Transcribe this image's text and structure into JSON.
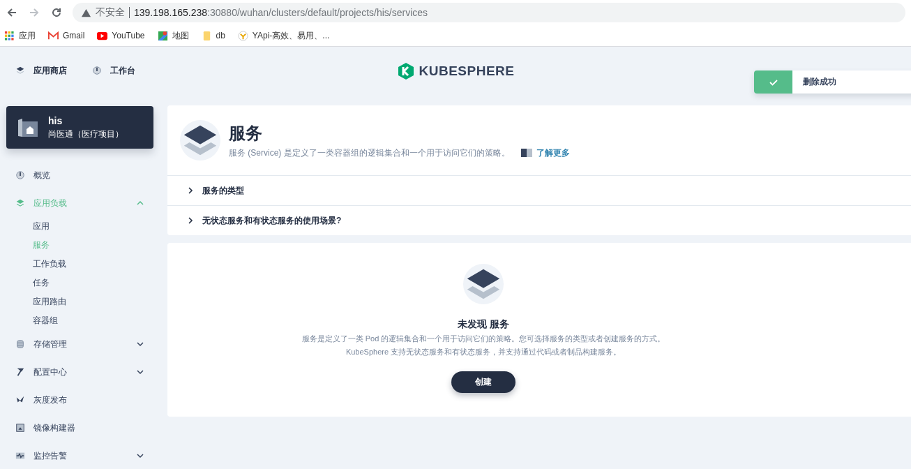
{
  "browser": {
    "security_label": "不安全",
    "url_host": "139.198.165.238",
    "url_path": ":30880/wuhan/clusters/default/projects/his/services",
    "bookmarks": [
      {
        "kind": "apps",
        "label": "应用"
      },
      {
        "kind": "gmail",
        "label": "Gmail"
      },
      {
        "kind": "youtube",
        "label": "YouTube"
      },
      {
        "kind": "maps",
        "label": "地图"
      },
      {
        "kind": "folder",
        "label": "db"
      },
      {
        "kind": "yapi",
        "label": "YApi-高效、易用、..."
      }
    ]
  },
  "header": {
    "top_links": [
      {
        "kind": "store",
        "label": "应用商店"
      },
      {
        "kind": "workbench",
        "label": "工作台"
      }
    ],
    "logo_text": "KUBESPHERE"
  },
  "toast": {
    "message": "删除成功"
  },
  "project": {
    "name": "his",
    "description": "尚医通（医疗项目）"
  },
  "nav": [
    {
      "kind": "overview",
      "label": "概览",
      "selected": false
    },
    {
      "kind": "workloads",
      "label": "应用负载",
      "selected": true,
      "expanded": true,
      "children": [
        {
          "label": "应用",
          "selected": false
        },
        {
          "label": "服务",
          "selected": true
        },
        {
          "label": "工作负载",
          "selected": false
        },
        {
          "label": "任务",
          "selected": false
        },
        {
          "label": "应用路由",
          "selected": false
        },
        {
          "label": "容器组",
          "selected": false
        }
      ]
    },
    {
      "kind": "storage",
      "label": "存储管理",
      "selected": false,
      "expanded": false
    },
    {
      "kind": "config",
      "label": "配置中心",
      "selected": false,
      "expanded": false
    },
    {
      "kind": "grayscale",
      "label": "灰度发布",
      "selected": false
    },
    {
      "kind": "image",
      "label": "镜像构建器",
      "selected": false
    },
    {
      "kind": "monitor",
      "label": "监控告警",
      "selected": false,
      "expanded": false
    }
  ],
  "page": {
    "title": "服务",
    "description": "服务 (Service) 是定义了一类容器组的逻辑集合和一个用于访问它们的策略。",
    "learn_more": "了解更多",
    "faq": [
      {
        "label": "服务的类型",
        "expanded": false
      },
      {
        "label": "无状态服务和有状态服务的使用场景?",
        "expanded": false
      }
    ]
  },
  "empty": {
    "title": "未发现 服务",
    "lines": [
      "服务是定义了一类 Pod 的逻辑集合和一个用于访问它们的策略。您可选择服务的类型或者创建服务的方式。",
      "KubeSphere 支持无状态服务和有状态服务，并支持通过代码或者制品构建服务。"
    ],
    "button": "创建"
  }
}
